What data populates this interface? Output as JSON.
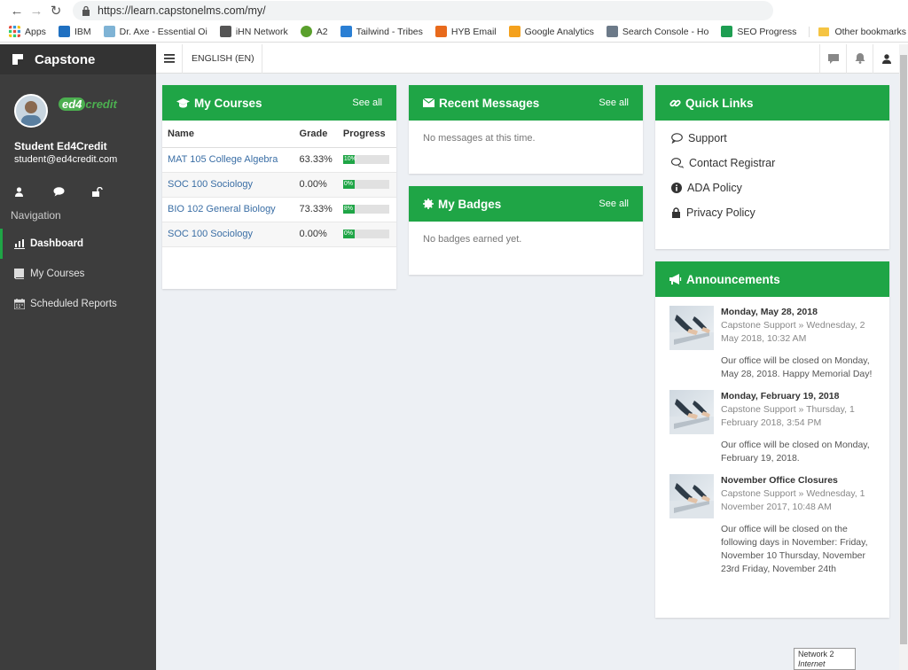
{
  "browser": {
    "url": "https://learn.capstonelms.com/my/",
    "bookmarks": [
      {
        "label": "Apps",
        "color": "#e74c3c"
      },
      {
        "label": "IBM",
        "color": "#1f70c1"
      },
      {
        "label": "Dr. Axe - Essential Oi",
        "color": "#7fb3d5"
      },
      {
        "label": "iHN Network",
        "color": "#555555"
      },
      {
        "label": "A2",
        "color": "#5aa02c"
      },
      {
        "label": "Tailwind - Tribes",
        "color": "#2a7fd4"
      },
      {
        "label": "HYB Email",
        "color": "#e86a1c"
      },
      {
        "label": "Google Analytics",
        "color": "#f4a11d"
      },
      {
        "label": "Search Console - Ho",
        "color": "#6c7a89"
      },
      {
        "label": "SEO Progress",
        "color": "#1e9e52"
      }
    ],
    "other_bookmarks": "Other bookmarks"
  },
  "sidebar": {
    "brand": "Capstone",
    "partner_logo_a": "ed4",
    "partner_logo_b": "credit",
    "user_name": "Student Ed4Credit",
    "user_email": "student@ed4credit.com",
    "nav_heading": "Navigation",
    "items": [
      {
        "label": "Dashboard",
        "icon": "dashboard-icon"
      },
      {
        "label": "My Courses",
        "icon": "book-icon"
      },
      {
        "label": "Scheduled Reports",
        "icon": "calendar-icon"
      }
    ]
  },
  "topbar": {
    "language": "ENGLISH (EN)"
  },
  "courses": {
    "title": "My Courses",
    "see_all": "See all",
    "headers": [
      "Name",
      "Grade",
      "Progress"
    ],
    "rows": [
      {
        "name": "MAT 105 College Algebra",
        "grade": "63.33%",
        "progress": 10,
        "progress_label": "10%"
      },
      {
        "name": "SOC 100 Sociology",
        "grade": "0.00%",
        "progress": 0,
        "progress_label": "0%"
      },
      {
        "name": "BIO 102 General Biology",
        "grade": "73.33%",
        "progress": 8,
        "progress_label": "8%"
      },
      {
        "name": "SOC 100 Sociology",
        "grade": "0.00%",
        "progress": 0,
        "progress_label": "0%"
      }
    ]
  },
  "messages": {
    "title": "Recent Messages",
    "see_all": "See all",
    "empty": "No messages at this time."
  },
  "badges": {
    "title": "My Badges",
    "see_all": "See all",
    "empty": "No badges earned yet."
  },
  "quick_links": {
    "title": "Quick Links",
    "items": [
      {
        "label": "Support",
        "icon": "comment-icon"
      },
      {
        "label": "Contact Registrar",
        "icon": "comments-icon"
      },
      {
        "label": "ADA Policy",
        "icon": "info-icon"
      },
      {
        "label": "Privacy Policy",
        "icon": "lock-icon"
      }
    ]
  },
  "announcements": {
    "title": "Announcements",
    "items": [
      {
        "title": "Monday, May 28, 2018",
        "meta": "Capstone Support » Wednesday, 2 May 2018, 10:32 AM",
        "text": "Our office will be closed on Monday, May 28, 2018. Happy Memorial Day!"
      },
      {
        "title": "Monday, February 19, 2018",
        "meta": "Capstone Support » Thursday, 1 February 2018, 3:54 PM",
        "text": "Our office will be closed on Monday, February 19, 2018."
      },
      {
        "title": "November Office Closures",
        "meta": "Capstone Support » Wednesday, 1 November 2017, 10:48 AM",
        "text": "Our office will be closed on the following days in November: Friday, November 10 Thursday, November 23rd Friday, November 24th"
      }
    ]
  },
  "network_tip": {
    "title": "Network 2",
    "status": "Internet access"
  },
  "colors": {
    "green": "#1fa546",
    "sidebar": "#3d3d3d",
    "link": "#3a6ea5"
  }
}
